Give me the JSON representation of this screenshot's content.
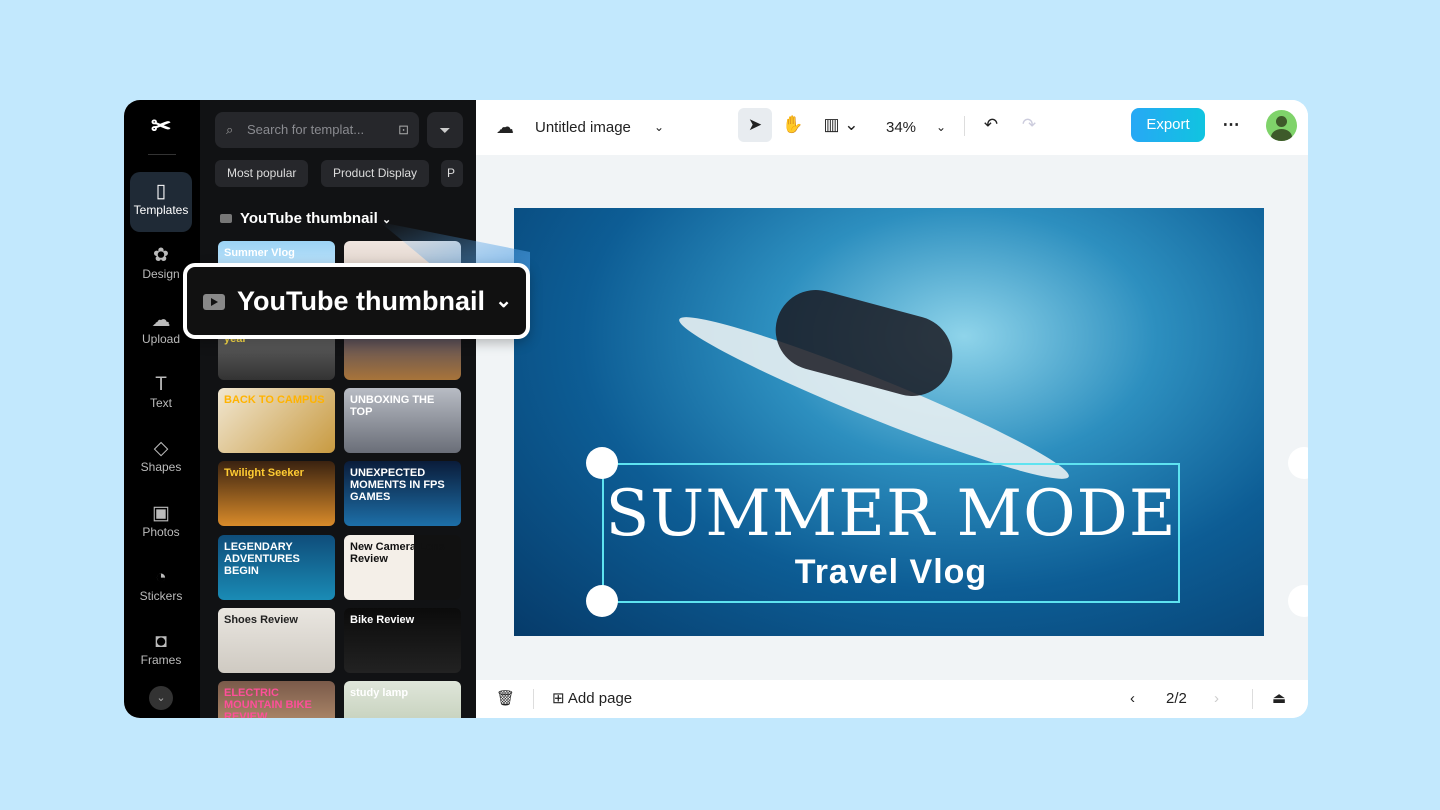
{
  "app": {
    "logo": "CapCut"
  },
  "rail": {
    "items": [
      {
        "label": "Templates",
        "icon": "templates-icon",
        "glyph": "▯",
        "active": true
      },
      {
        "label": "Design",
        "icon": "design-icon",
        "glyph": "✿"
      },
      {
        "label": "Upload",
        "icon": "upload-icon",
        "glyph": "☁"
      },
      {
        "label": "Text",
        "icon": "text-icon",
        "glyph": "T"
      },
      {
        "label": "Shapes",
        "icon": "shapes-icon",
        "glyph": "◇"
      },
      {
        "label": "Photos",
        "icon": "photos-icon",
        "glyph": "▣"
      },
      {
        "label": "Stickers",
        "icon": "stickers-icon",
        "glyph": "◔"
      },
      {
        "label": "Frames",
        "icon": "frames-icon",
        "glyph": "◘"
      }
    ]
  },
  "panel": {
    "search_placeholder": "Search for templat...",
    "chips": [
      "Most popular",
      "Product Display",
      "P"
    ],
    "section": "YouTube thumbnail",
    "thumbnails": [
      "Summer Vlog",
      "",
      "Smartphone of the year",
      "",
      "BACK TO CAMPUS",
      "UNBOXING THE TOP",
      "Twilight Seeker",
      "UNEXPECTED MOMENTS IN FPS GAMES",
      "LEGENDARY ADVENTURES BEGIN",
      "New Camera Lens Review",
      "Shoes Review",
      "Bike Review",
      "ELECTRIC MOUNTAIN BIKE REVIEW",
      "study lamp"
    ]
  },
  "callout": {
    "label": "YouTube thumbnail"
  },
  "topbar": {
    "title": "Untitled image",
    "zoom": "34%",
    "export": "Export"
  },
  "canvas": {
    "headline": "SUMMER MODE",
    "subhead": "Travel Vlog"
  },
  "bottom": {
    "add_page": "Add page",
    "page": "2/2"
  },
  "colors": {
    "accent": "#10c4e0",
    "selection": "#5ee3f0",
    "background": "#c2e8fd"
  }
}
